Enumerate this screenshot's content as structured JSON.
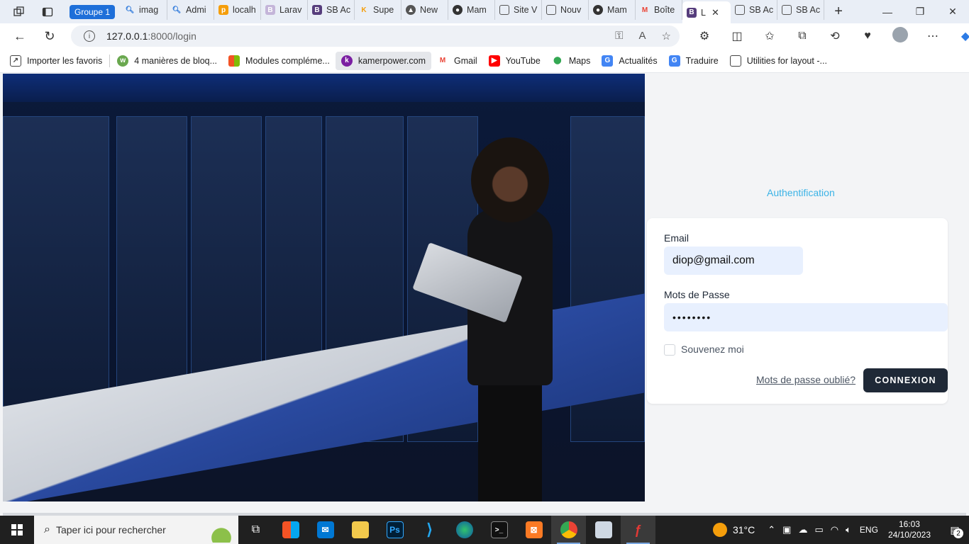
{
  "browser": {
    "group_label": "Groupe 1",
    "tabs": [
      {
        "label": "imag",
        "favicon": "search-icon"
      },
      {
        "label": "Admi",
        "favicon": "search-icon"
      },
      {
        "label": "localh",
        "favicon": "phpmyadmin-icon"
      },
      {
        "label": "Larav",
        "favicon": "bootstrap-icon"
      },
      {
        "label": "SB Ac",
        "favicon": "bootstrap-icon"
      },
      {
        "label": "Supe",
        "favicon": "k-icon"
      },
      {
        "label": "New",
        "favicon": "triangle-icon"
      },
      {
        "label": "Mam",
        "favicon": "github-icon"
      },
      {
        "label": "Site V",
        "favicon": "page-icon"
      },
      {
        "label": "Nouv",
        "favicon": "form-icon"
      },
      {
        "label": "Mam",
        "favicon": "github-icon"
      },
      {
        "label": "Boîte",
        "favicon": "gmail-icon"
      },
      {
        "label": "L",
        "favicon": "bootstrap-icon",
        "active": true
      },
      {
        "label": "SB Ac",
        "favicon": "page-icon"
      },
      {
        "label": "SB Ac",
        "favicon": "page-icon"
      }
    ],
    "address": {
      "host": "127.0.0.1",
      "path": ":8000/login"
    }
  },
  "favorites": [
    {
      "label": "Importer les favoris",
      "icon": "import-icon"
    },
    {
      "label": "4 manières de bloq...",
      "icon": "wikihow-icon"
    },
    {
      "label": "Modules compléme...",
      "icon": "microsoft-icon"
    },
    {
      "label": "kamerpower.com",
      "icon": "kamerpower-icon",
      "highlight": true
    },
    {
      "label": "Gmail",
      "icon": "gmail-icon"
    },
    {
      "label": "YouTube",
      "icon": "youtube-icon"
    },
    {
      "label": "Maps",
      "icon": "maps-icon"
    },
    {
      "label": "Actualités",
      "icon": "news-icon"
    },
    {
      "label": "Traduire",
      "icon": "translate-icon"
    },
    {
      "label": "Utilities for layout -...",
      "icon": "page-icon"
    }
  ],
  "page": {
    "auth_title": "Authentification",
    "email_label": "Email",
    "email_value": "diop@gmail.com",
    "password_label": "Mots de Passe",
    "password_value": "••••••••",
    "remember_label": "Souvenez moi",
    "forgot_label": "Mots de passe oublié?",
    "submit_label": "CONNEXION"
  },
  "taskbar": {
    "search_placeholder": "Taper ici pour rechercher",
    "temperature": "31°C",
    "language": "ENG",
    "time": "16:03",
    "date": "24/10/2023",
    "notification_count": "2"
  },
  "colors": {
    "accent_link": "#3bb3e6",
    "button_dark": "#1f2937",
    "autofill_bg": "#e8f0fe",
    "group_chip": "#1e6fd9"
  }
}
